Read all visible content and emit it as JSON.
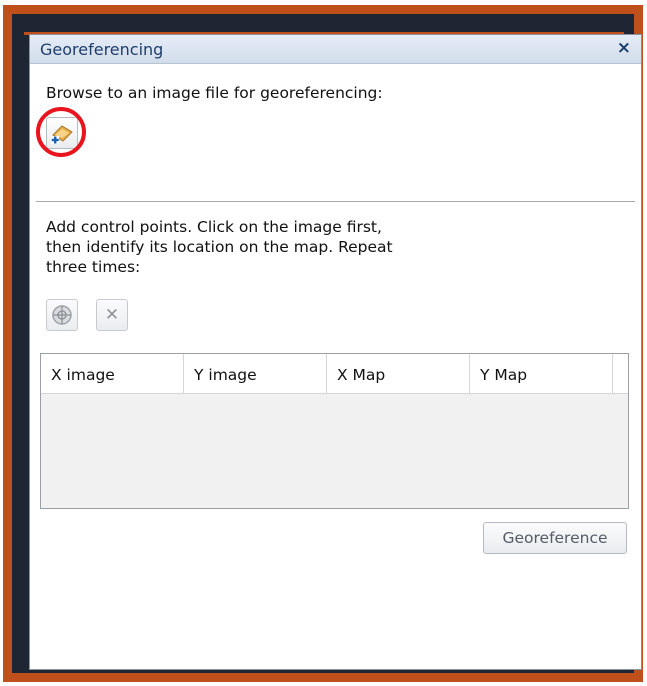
{
  "window": {
    "title": "Georeferencing",
    "close_icon": "×"
  },
  "browse": {
    "instruction": "Browse to an image file for georeferencing:",
    "button_icon": "add-image-icon"
  },
  "control_points": {
    "line1": "Add control points. Click on the image first,",
    "line2": "then identify its location on the map. Repeat",
    "line3": "three times:",
    "add_point_icon": "crosshair-icon",
    "delete_point_icon": "delete-x-icon",
    "delete_symbol": "✕"
  },
  "grid": {
    "columns": [
      "X image",
      "Y image",
      "X Map",
      "Y Map"
    ],
    "rows": []
  },
  "actions": {
    "georeference_label": "Georeference"
  },
  "colors": {
    "frame": "#c0501b",
    "highlight": "#e8141e",
    "title_text": "#1e3e6a"
  }
}
